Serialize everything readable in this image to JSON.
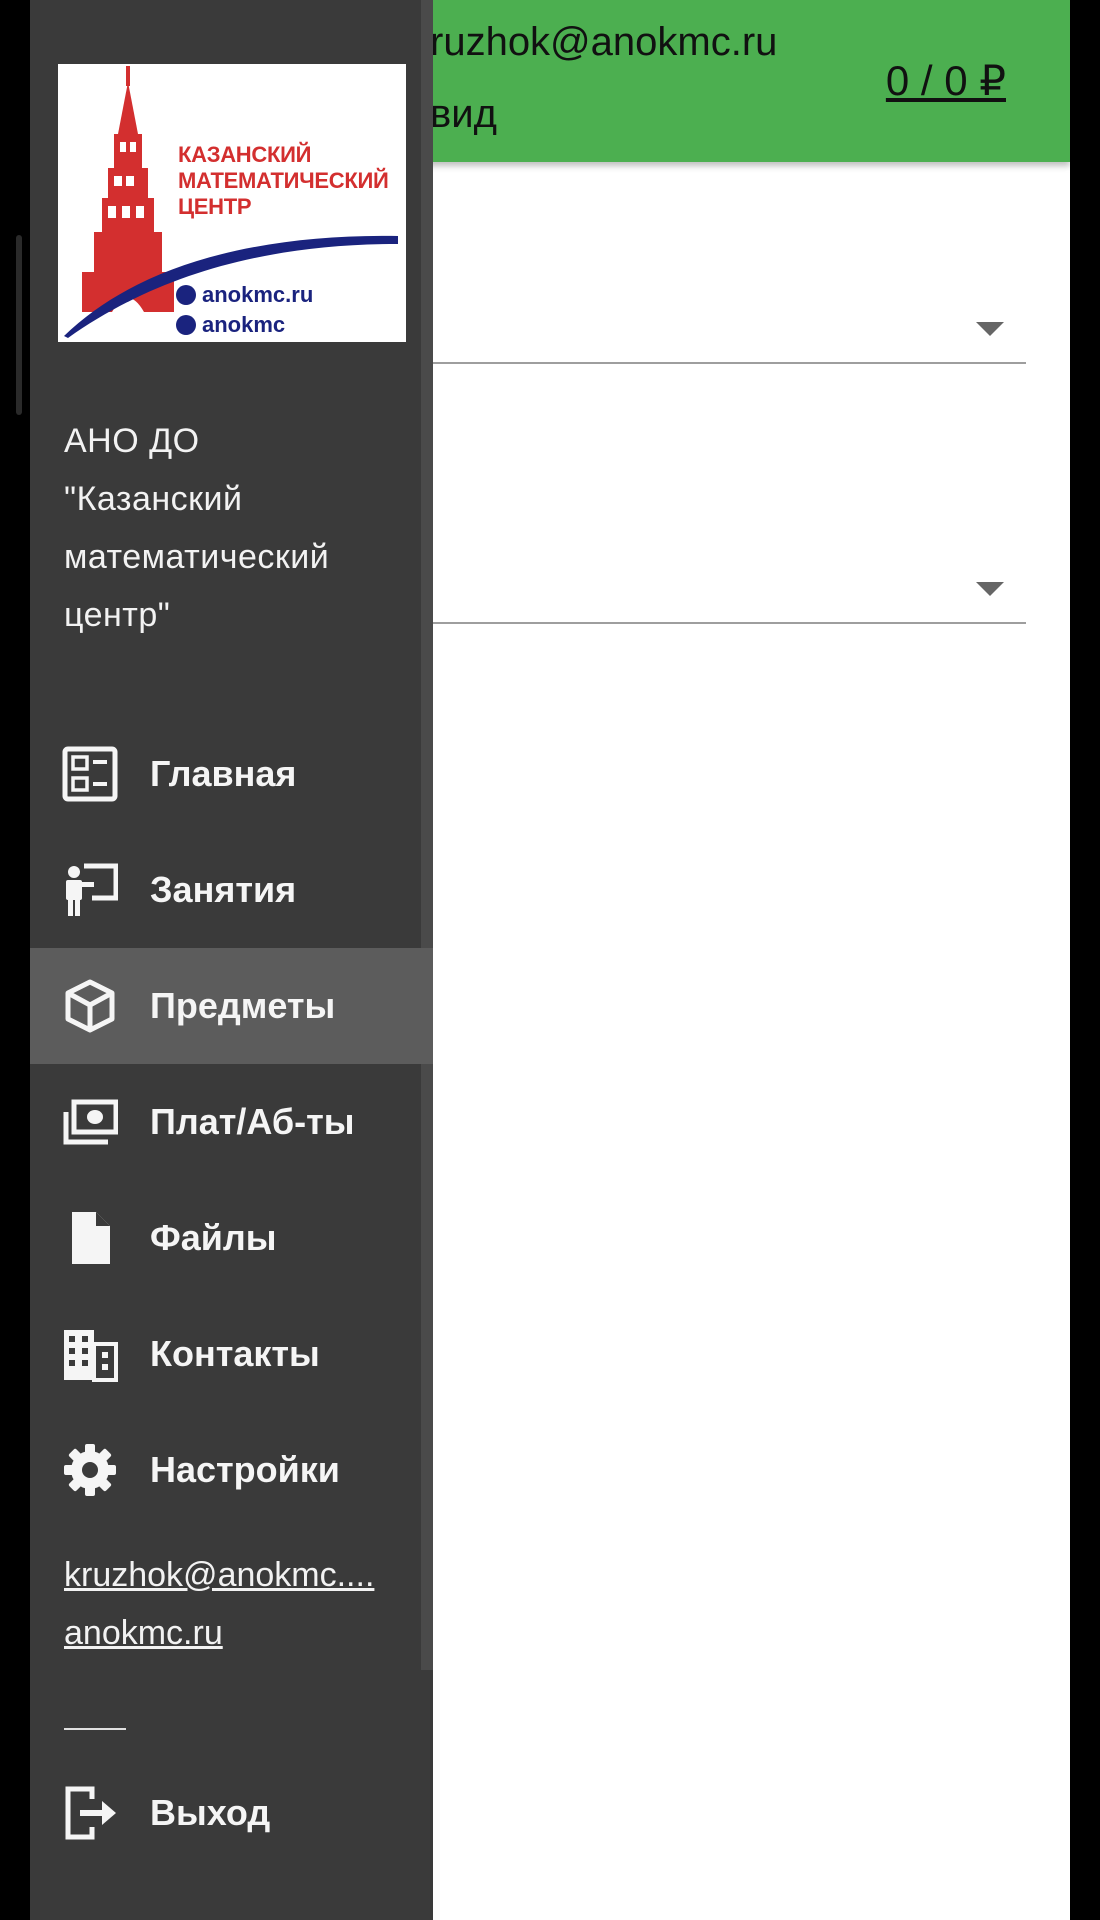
{
  "topbar": {
    "email": "ruzhok@anokmc.ru",
    "subtitle": "вид",
    "balance": "0 / 0 ₽"
  },
  "logo": {
    "title_lines": [
      "КАЗАНСКИЙ",
      "МАТЕМАТИЧЕСКИЙ",
      "ЦЕНТР"
    ],
    "website": "anokmc.ru",
    "vk": "anokmc",
    "colors": {
      "tower": "#d32f2f",
      "text": "#d32f2f",
      "swoosh": "#1a237e"
    }
  },
  "drawer": {
    "org_name_lines": [
      "АНО ДО",
      "\"Казанский",
      "математический",
      "центр\""
    ],
    "nav_items": [
      {
        "label": "Главная",
        "icon": "dashboard-icon"
      },
      {
        "label": "Занятия",
        "icon": "teacher-icon"
      },
      {
        "label": "Предметы",
        "icon": "cube-icon",
        "active": true
      },
      {
        "label": "Плат/Аб-ты",
        "icon": "payments-icon"
      },
      {
        "label": "Файлы",
        "icon": "file-icon"
      },
      {
        "label": "Контакты",
        "icon": "building-icon"
      },
      {
        "label": "Настройки",
        "icon": "gear-icon"
      }
    ],
    "email_link": "kruzhok@anokmc....",
    "site_link": "anokmc.ru",
    "logout": {
      "label": "Выход",
      "icon": "logout-icon"
    }
  },
  "colors": {
    "accent_green": "#4caf50",
    "drawer_bg": "#3a3a3a",
    "active_item_bg": "#5c5c5c"
  }
}
